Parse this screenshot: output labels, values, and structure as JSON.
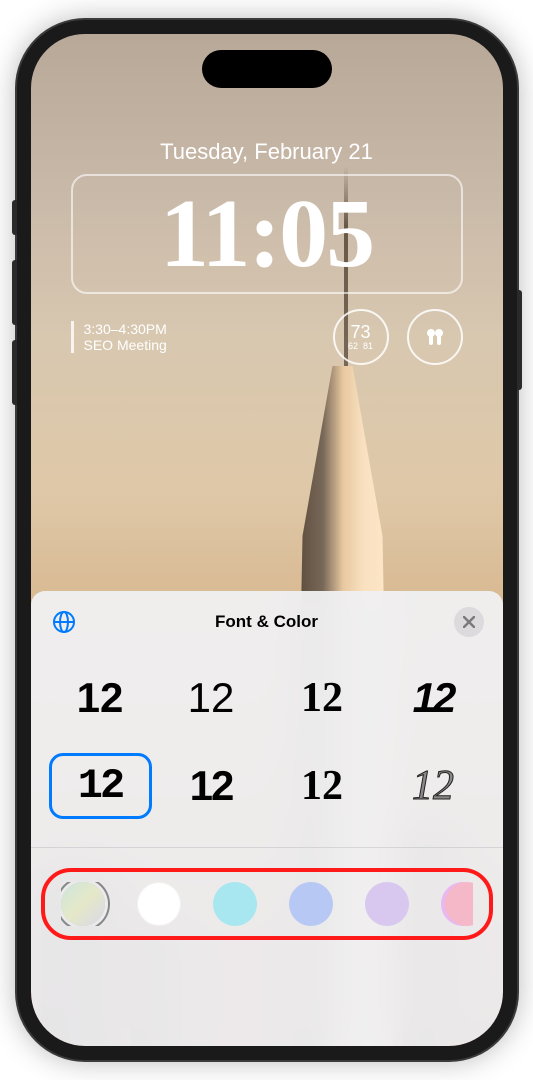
{
  "lockscreen": {
    "date": "Tuesday, February 21",
    "time": "11:05",
    "calendar": {
      "time_range": "3:30–4:30PM",
      "title": "SEO Meeting"
    },
    "weather": {
      "current": "73",
      "low": "62",
      "high": "81"
    },
    "battery_icon": "🎧"
  },
  "sheet": {
    "title": "Font & Color",
    "font_sample": "12",
    "fonts": [
      {
        "style": "f1",
        "selected": false
      },
      {
        "style": "f2",
        "selected": false
      },
      {
        "style": "f3",
        "selected": false
      },
      {
        "style": "f4",
        "selected": false
      },
      {
        "style": "f5",
        "selected": true
      },
      {
        "style": "f6",
        "selected": false
      },
      {
        "style": "f7",
        "selected": false
      },
      {
        "style": "f8",
        "selected": false
      }
    ],
    "colors": [
      {
        "class": "c-gradient",
        "selected": true,
        "name": "gradient"
      },
      {
        "class": "c-white",
        "selected": false,
        "name": "white"
      },
      {
        "class": "c-cyan",
        "selected": false,
        "name": "cyan"
      },
      {
        "class": "c-blue",
        "selected": false,
        "name": "blue"
      },
      {
        "class": "c-lavender",
        "selected": false,
        "name": "lavender"
      },
      {
        "class": "c-pink",
        "selected": false,
        "name": "pink"
      }
    ]
  }
}
